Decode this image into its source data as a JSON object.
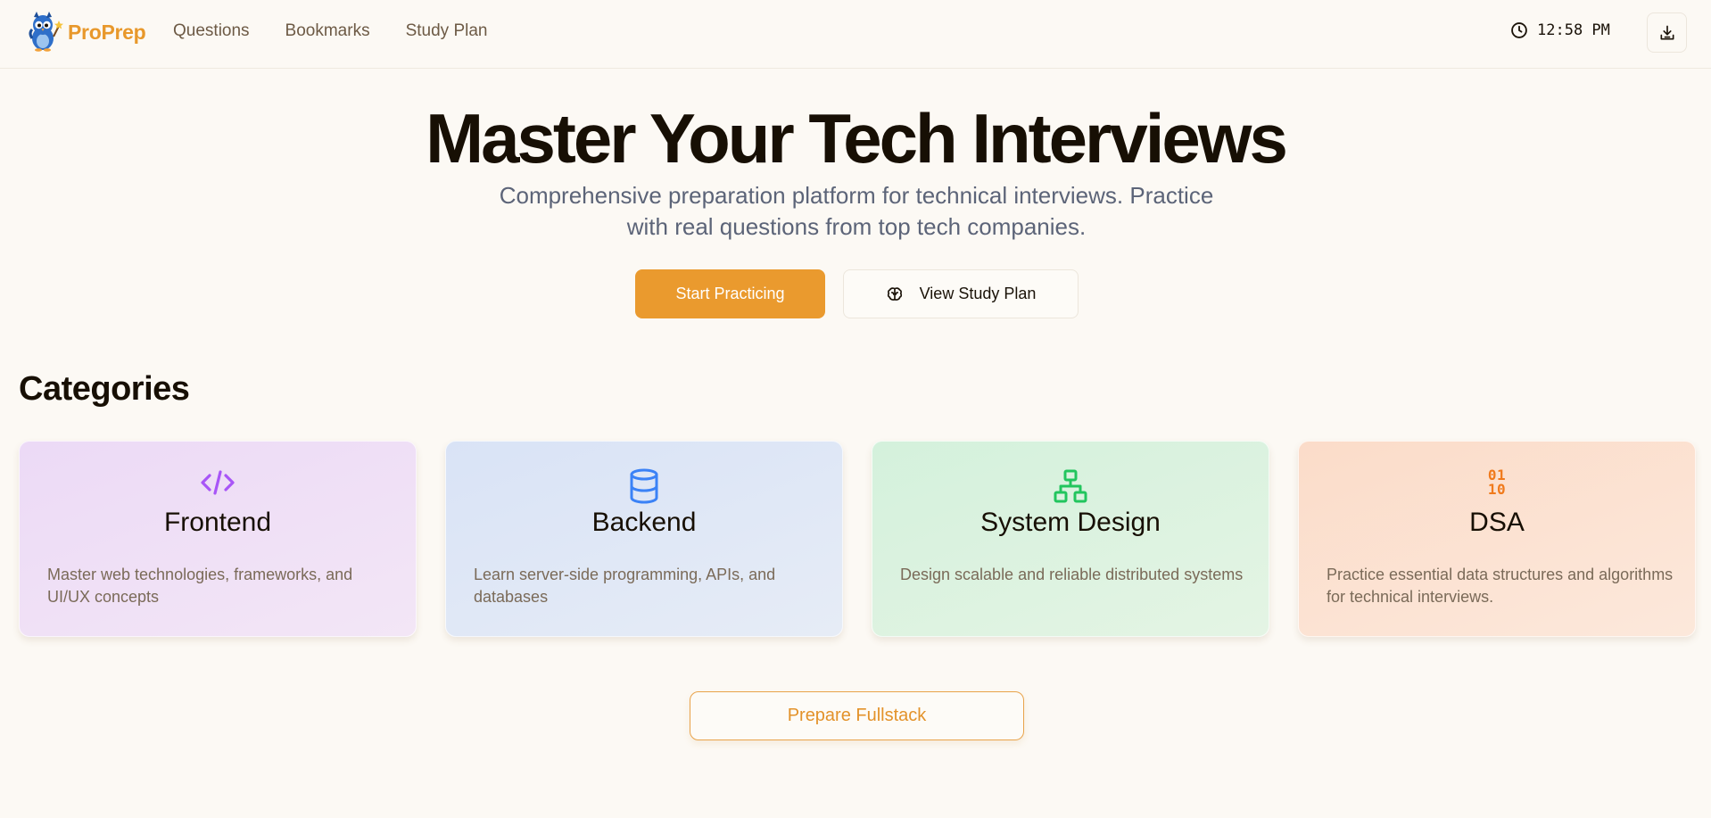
{
  "brand": {
    "name": "ProPrep"
  },
  "nav": {
    "items": [
      {
        "label": "Questions"
      },
      {
        "label": "Bookmarks"
      },
      {
        "label": "Study Plan"
      }
    ]
  },
  "header": {
    "time": "12:58 PM",
    "clock_icon": "clock-icon",
    "download_icon": "download-icon"
  },
  "hero": {
    "title": "Master Your Tech Interviews",
    "subtitle": "Comprehensive preparation platform for technical interviews. Practice with real questions from top tech companies.",
    "primary_label": "Start Practicing",
    "secondary_label": "View Study Plan",
    "secondary_icon": "brain-icon"
  },
  "categories": {
    "heading": "Categories",
    "items": [
      {
        "title": "Frontend",
        "description": "Master web technologies, frameworks, and UI/UX concepts",
        "icon": "code-icon",
        "accent": "#a855f7"
      },
      {
        "title": "Backend",
        "description": "Learn server-side programming, APIs, and databases",
        "icon": "database-icon",
        "accent": "#3b82f6"
      },
      {
        "title": "System Design",
        "description": "Design scalable and reliable distributed systems",
        "icon": "network-icon",
        "accent": "#22c55e"
      },
      {
        "title": "DSA",
        "description": "Practice essential data structures and algorithms for technical interviews.",
        "icon": "binary-icon",
        "icon_text": [
          "01",
          "10"
        ],
        "accent": "#f07a1c"
      }
    ]
  },
  "fullstack": {
    "label": "Prepare Fullstack"
  },
  "colors": {
    "brand": "#e8982b",
    "primary_button": "#ea9a2e",
    "background": "#fcf9f4"
  }
}
